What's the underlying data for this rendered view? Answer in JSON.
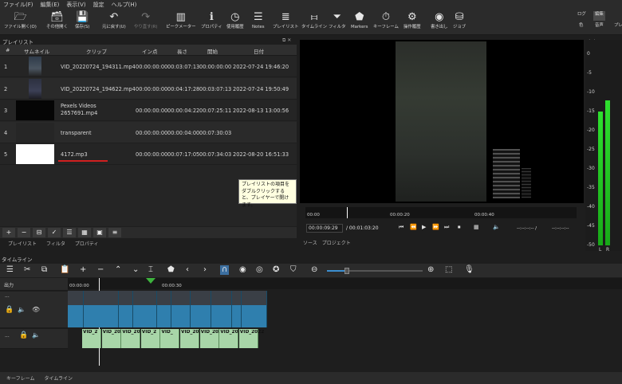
{
  "menu": [
    "ファイル(F)",
    "編集(E)",
    "表示(V)",
    "設定",
    "ヘルプ(H)"
  ],
  "toolbar": [
    {
      "icon": "folder-icon",
      "label": "ファイル開く(O)"
    },
    {
      "icon": "open-other-icon",
      "label": "その他開く"
    },
    {
      "icon": "save-icon",
      "label": "保存(S)"
    },
    {
      "icon": "undo-icon",
      "label": "元に戻す(U)"
    },
    {
      "icon": "redo-icon",
      "label": "やり直す(R)"
    },
    {
      "icon": "peak-meter-icon",
      "label": "ピークメーター"
    },
    {
      "icon": "properties-icon",
      "label": "プロパティ"
    },
    {
      "icon": "history-icon",
      "label": "使用履歴"
    },
    {
      "icon": "notes-icon",
      "label": "Notes"
    },
    {
      "icon": "playlist-icon",
      "label": "プレイリスト"
    },
    {
      "icon": "timeline-icon",
      "label": "タイムライン"
    },
    {
      "icon": "filter-icon",
      "label": "フィルタ"
    },
    {
      "icon": "markers-icon",
      "label": "Markers"
    },
    {
      "icon": "keyframe-icon",
      "label": "キーフレーム"
    },
    {
      "icon": "history2-icon",
      "label": "操作履歴"
    },
    {
      "icon": "export-icon",
      "label": "書き出し"
    },
    {
      "icon": "jobs-icon",
      "label": "ジョブ"
    },
    {
      "icon": "",
      "label": "ログ"
    },
    {
      "icon": "",
      "label": "編集"
    },
    {
      "icon": "",
      "label": "色"
    },
    {
      "icon": "",
      "label": "音声"
    },
    {
      "icon": "",
      "label": "プレ"
    }
  ],
  "playlist": {
    "title": "プレイリスト",
    "headers": [
      "#",
      "サムネイル",
      "クリップ",
      "イン点",
      "長さ",
      "開始",
      "日付"
    ],
    "rows": [
      {
        "num": "1",
        "clip": "VID_20220724_194311.mp4",
        "in": "00:00:00:00",
        "dur": "00:03:07:13",
        "start": "00:00:00:00",
        "date": "2022-07-24 19:46:20"
      },
      {
        "num": "2",
        "clip": "VID_20220724_194622.mp4",
        "in": "00:00:00:00",
        "dur": "00:04:17:28",
        "start": "00:03:07:13",
        "date": "2022-07-24 19:50:49"
      },
      {
        "num": "3",
        "clip": "Pexels Videos 2657691.mp4",
        "in": "00:00:00:00",
        "dur": "00:00:04:22",
        "start": "00:07:25:11",
        "date": "2022-08-13 13:00:56"
      },
      {
        "num": "4",
        "clip": "transparent",
        "in": "00:00:00:00",
        "dur": "00:00:04:00",
        "start": "00:07:30:03",
        "date": ""
      },
      {
        "num": "5",
        "clip": "4172.mp3",
        "in": "00:00:00:00",
        "dur": "00:07:17:05",
        "start": "00:07:34:03",
        "date": "2022-08-20 16:51:33"
      }
    ],
    "tabs": [
      "プレイリスト",
      "フィルタ",
      "プロパティ"
    ],
    "tooltip": "プレイリストの項目をダブルクリックすると、プレイヤーで開けます。"
  },
  "viewer": {
    "ruler": [
      "00:00",
      "00:00:20",
      "00:00:40"
    ],
    "timecode": "00:00:09:29",
    "duration": "/ 00:01:03:20",
    "in_out": "--:--:--:-- /",
    "in_out2": "--:--:--:--",
    "tabs": [
      "ソース",
      "プロジェクト"
    ]
  },
  "meter": {
    "title": "音声...",
    "scale": [
      "0",
      "-5",
      "-10",
      "-15",
      "-20",
      "-25",
      "-30",
      "-35",
      "-40",
      "-45",
      "-50"
    ],
    "channels": [
      "L",
      "R"
    ],
    "levels_db": [
      -15,
      -12
    ]
  },
  "timeline": {
    "title": "タイムライン",
    "output_label": "出力",
    "ruler": [
      "00:00:00",
      "00:00:30"
    ],
    "audio_clips": [
      "VID_2",
      "VID_2022",
      "VID_2022",
      "VID_2",
      "VID_",
      "VID_202",
      "VID_2022",
      "VID_2022",
      "VID_2022"
    ],
    "bottom_tabs": [
      "キーフレーム",
      "タイムライン"
    ]
  }
}
